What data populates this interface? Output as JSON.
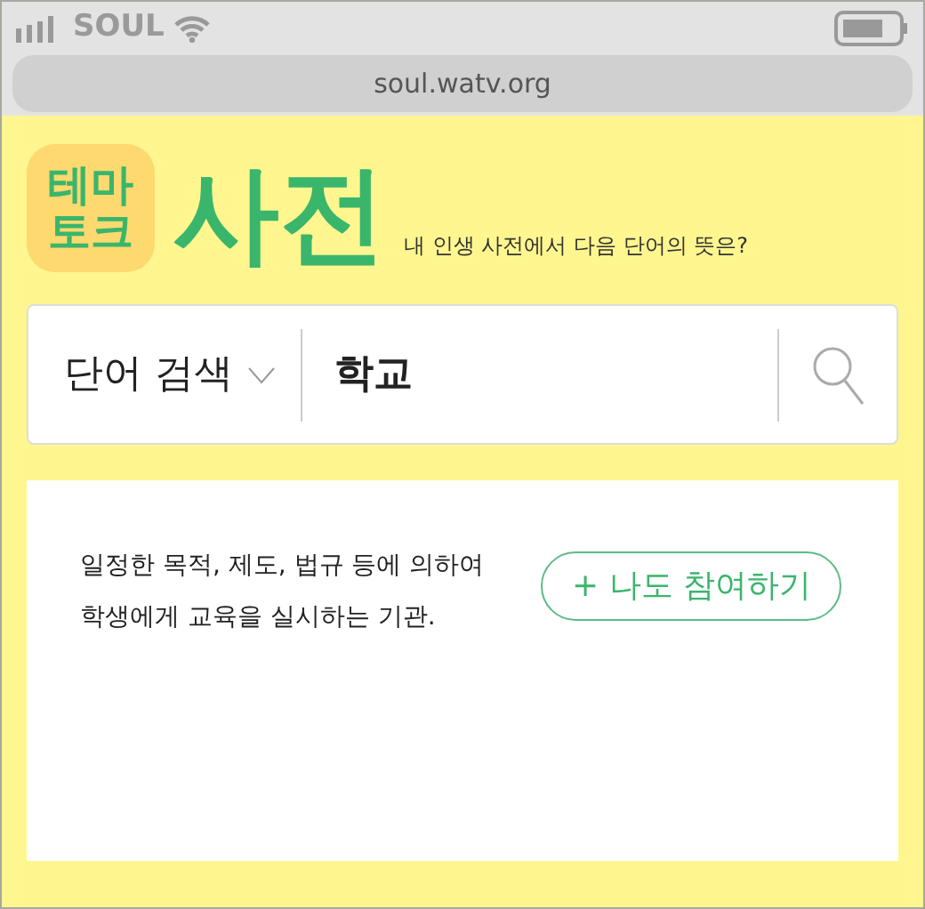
{
  "status_bar": {
    "carrier": "SOUL"
  },
  "address_bar": {
    "url": "soul.watv.org"
  },
  "header": {
    "badge": "테마토크",
    "title": "사전",
    "subtitle": "내 인생 사전에서 다음 단어의 뜻은?"
  },
  "search": {
    "scope": "단어 검색",
    "value": "학교"
  },
  "definition": {
    "lines": [
      "일정한 목적, 제도, 법규 등에 의하여",
      "학생에게 교육을 실시하는 기관."
    ],
    "join_button": "+ 나도 참여하기"
  }
}
